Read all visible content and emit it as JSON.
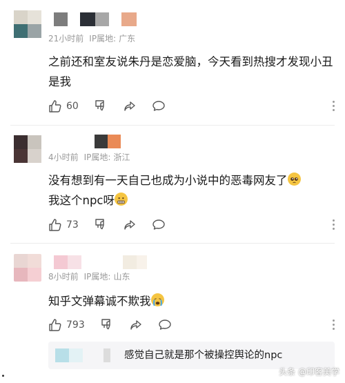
{
  "colors": {
    "meta": "#999999",
    "text": "#1a1a1a",
    "reply_bg": "#f5f5f7"
  },
  "comments": [
    {
      "time": "21小时前",
      "ip_label": "IP属地:",
      "ip_location": "广东",
      "text": "之前还和室友说朱丹是恋爱脑，今天看到热搜才发现小丑是我",
      "likes": "60"
    },
    {
      "time": "4小时前",
      "ip_label": "IP属地:",
      "ip_location": "浙江",
      "text_line1": "没有想到有一天自己也成为小说中的恶毒网友了",
      "text_line2": "我这个npc呀",
      "emoji1": "pleading-face",
      "emoji2": "grimacing-face",
      "likes": "73"
    },
    {
      "time": "8小时前",
      "ip_label": "IP属地:",
      "ip_location": "山东",
      "text": "知乎文弹幕诚不欺我",
      "emoji": "crying-face",
      "likes": "793",
      "reply": {
        "text": "感觉自己就是那个被操控舆论的npc"
      }
    }
  ],
  "watermark": "头条 @印客美学"
}
